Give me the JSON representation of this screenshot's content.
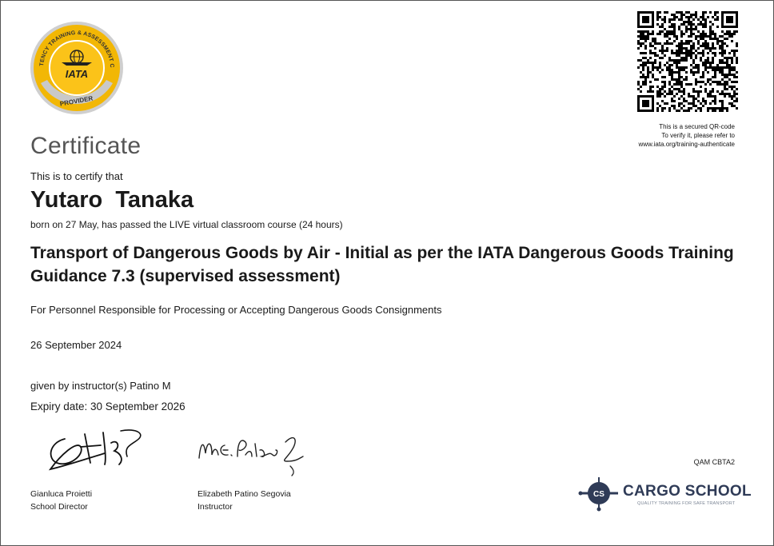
{
  "seal": {
    "ring_text": "COMPETENCY TRAINING & ASSESSMENT CENTER",
    "brand": "IATA",
    "bottom_text": "PROVIDER"
  },
  "qr": {
    "note_line1": "This is a secured QR-code",
    "note_line2": "To verify it, please refer to",
    "note_line3": "www.iata.org/training-authenticate"
  },
  "certificate": {
    "title": "Certificate",
    "certify_line": "This is to certify that",
    "recipient": "Yutaro  Tanaka",
    "born_line": "born on 27 May, has passed the LIVE virtual classroom course   (24 hours)",
    "course_title": "Transport of Dangerous Goods by Air - Initial as per the IATA Dangerous Goods Training Guidance 7.3 (supervised assessment)",
    "audience": "For Personnel Responsible for Processing or Accepting Dangerous Goods Consignments",
    "date": "26 September 2024",
    "instructor_line": "given by instructor(s) Patino M",
    "expiry_line": "Expiry date: 30 September 2026"
  },
  "signers": [
    {
      "name": "Gianluca Proietti",
      "role": "School Director"
    },
    {
      "name": "Elizabeth Patino Segovia",
      "role": "Instructor"
    }
  ],
  "footer": {
    "code": "QAM CBTA2",
    "logo_name": "CARGO SCHOOL",
    "logo_tagline": "QUALITY TRAINING FOR SAFE TRANSPORT",
    "logo_mark": "CS"
  },
  "colors": {
    "seal_ring": "#f2b705",
    "seal_inner": "#fbc319",
    "seal_outer": "#c9c9c9",
    "logo_navy": "#2f3b57"
  }
}
